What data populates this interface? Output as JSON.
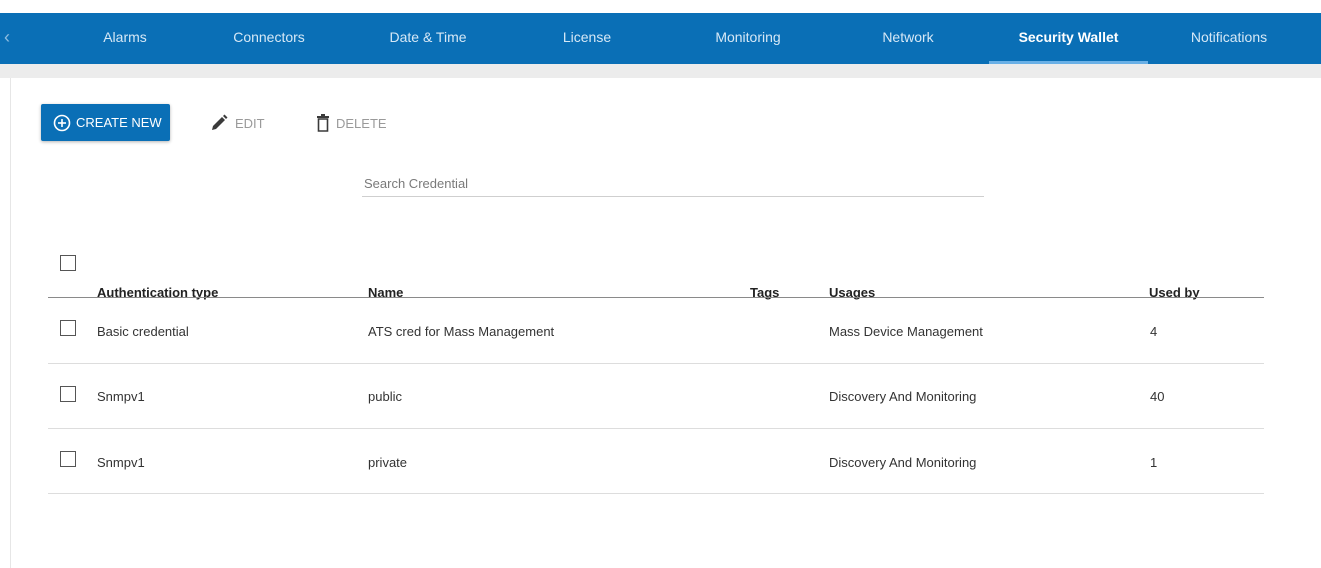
{
  "nav": {
    "tabs": [
      {
        "label": "Alarms"
      },
      {
        "label": "Connectors"
      },
      {
        "label": "Date & Time"
      },
      {
        "label": "License"
      },
      {
        "label": "Monitoring"
      },
      {
        "label": "Network"
      },
      {
        "label": "Security Wallet",
        "active": true
      },
      {
        "label": "Notifications"
      }
    ]
  },
  "toolbar": {
    "create_label": "CREATE NEW",
    "edit_label": "EDIT",
    "delete_label": "DELETE"
  },
  "search": {
    "placeholder": "Search Credential",
    "value": ""
  },
  "table": {
    "headers": {
      "auth_type": "Authentication type",
      "name": "Name",
      "tags": "Tags",
      "usages": "Usages",
      "used_by": "Used by"
    },
    "rows": [
      {
        "auth_type": "Basic credential",
        "name": "ATS cred for Mass Management",
        "tags": "",
        "usages": "Mass Device Management",
        "used_by": "4"
      },
      {
        "auth_type": "Snmpv1",
        "name": "public",
        "tags": "",
        "usages": "Discovery And Monitoring",
        "used_by": "40"
      },
      {
        "auth_type": "Snmpv1",
        "name": "private",
        "tags": "",
        "usages": "Discovery And Monitoring",
        "used_by": "1"
      }
    ]
  },
  "colors": {
    "nav_bg": "#0a6fb6",
    "primary": "#0a6fb6",
    "active_underline": "#6ab0e6"
  },
  "icons": {
    "nav_back": "chevron-left-icon",
    "create": "plus-circle-icon",
    "edit": "pencil-icon",
    "delete": "trash-icon"
  }
}
